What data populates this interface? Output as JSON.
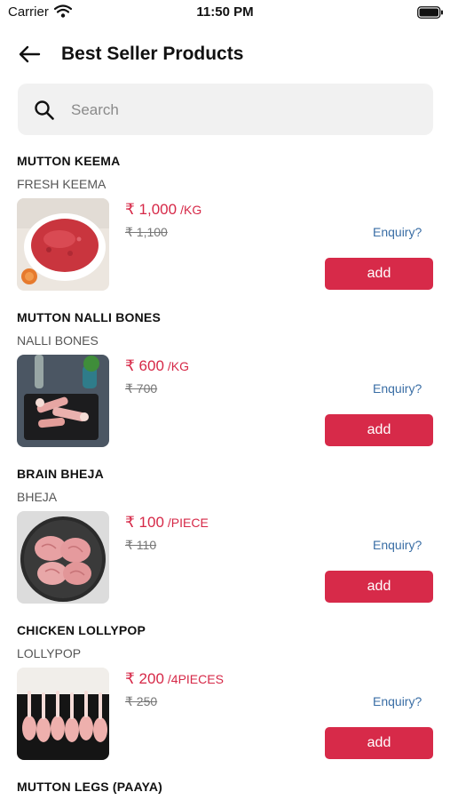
{
  "status_bar": {
    "carrier": "Carrier",
    "time": "11:50 PM"
  },
  "header": {
    "title": "Best Seller Products"
  },
  "search": {
    "placeholder": "Search"
  },
  "products": [
    {
      "name": "MUTTON KEEMA",
      "subtitle": "FRESH KEEMA",
      "price": "₹ 1,000",
      "unit": "/KG",
      "mrp": "₹ 1,100",
      "enquiry": "Enquiry?",
      "add_label": "add"
    },
    {
      "name": "MUTTON NALLI BONES",
      "subtitle": "NALLI BONES",
      "price": "₹ 600",
      "unit": "/KG",
      "mrp": "₹ 700",
      "enquiry": "Enquiry?",
      "add_label": "add"
    },
    {
      "name": "BRAIN BHEJA",
      "subtitle": "BHEJA",
      "price": "₹ 100",
      "unit": "/PIECE",
      "mrp": "₹ 110",
      "enquiry": "Enquiry?",
      "add_label": "add"
    },
    {
      "name": "CHICKEN LOLLYPOP",
      "subtitle": "LOLLYPOP",
      "price": "₹ 200",
      "unit": "/4PIECES",
      "mrp": "₹ 250",
      "enquiry": "Enquiry?",
      "add_label": "add"
    },
    {
      "name": "MUTTON LEGS (PAAYA)"
    }
  ],
  "colors": {
    "accent": "#d72a49",
    "price": "#d62847",
    "link": "#3a6ea5",
    "search_bg": "#f1f1f1"
  }
}
